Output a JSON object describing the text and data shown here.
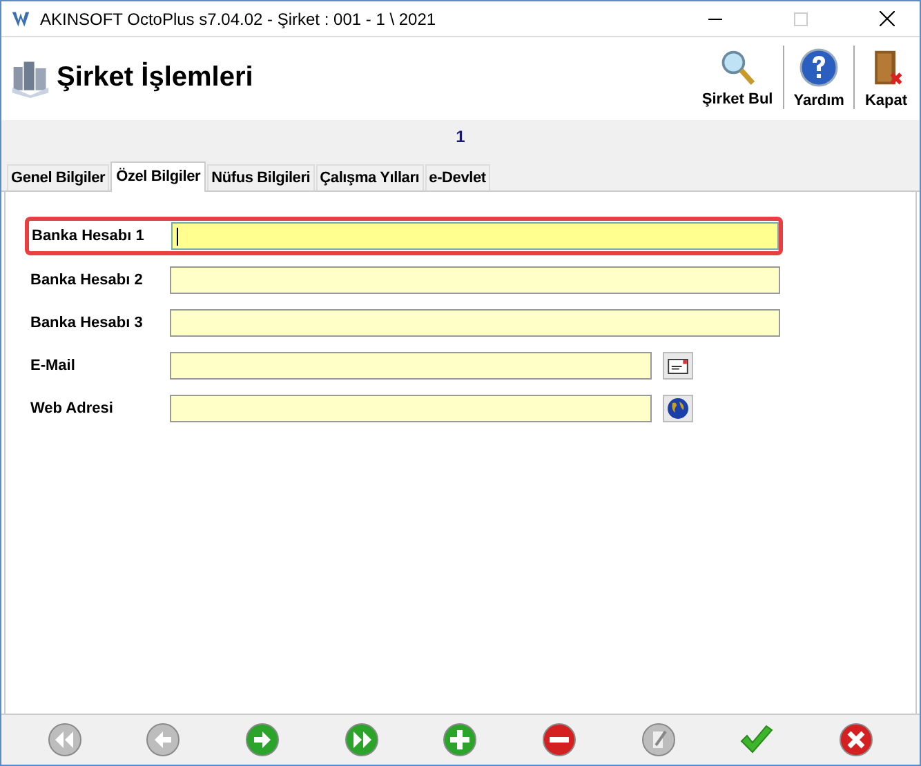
{
  "window": {
    "title": "AKINSOFT OctoPlus s7.04.02  -  Şirket : 001 - 1 \\ 2021"
  },
  "header": {
    "title": "Şirket İşlemleri",
    "tools": [
      {
        "label": "Şirket Bul",
        "kind": "search"
      },
      {
        "label": "Yardım",
        "kind": "help"
      },
      {
        "label": "Kapat",
        "kind": "close"
      }
    ]
  },
  "record_band": {
    "text": "1"
  },
  "tabs": [
    {
      "label": "Genel Bilgiler",
      "selected": false
    },
    {
      "label": "Özel Bilgiler",
      "selected": true
    },
    {
      "label": "Nüfus Bilgileri",
      "selected": false
    },
    {
      "label": "Çalışma Yılları",
      "selected": false
    },
    {
      "label": "e-Devlet",
      "selected": false
    }
  ],
  "fields": [
    {
      "label": "Banka Hesabı 1",
      "focused": true
    },
    {
      "label": "Banka Hesabı 2",
      "focused": false
    },
    {
      "label": "Banka Hesabı 3",
      "focused": false
    },
    {
      "label": "E-Mail",
      "focused": false,
      "kind": "mail"
    },
    {
      "label": "Web Adresi",
      "focused": false,
      "kind": "web"
    }
  ],
  "nav_buttons": [
    {
      "kind": "first",
      "disabled": true
    },
    {
      "kind": "prev",
      "disabled": true
    },
    {
      "kind": "next",
      "disabled": false
    },
    {
      "kind": "last",
      "disabled": false
    },
    {
      "kind": "add",
      "disabled": false
    },
    {
      "kind": "delete",
      "disabled": false
    },
    {
      "kind": "edit",
      "disabled": true
    },
    {
      "kind": "save",
      "disabled": false
    },
    {
      "kind": "cancel",
      "disabled": false
    }
  ]
}
